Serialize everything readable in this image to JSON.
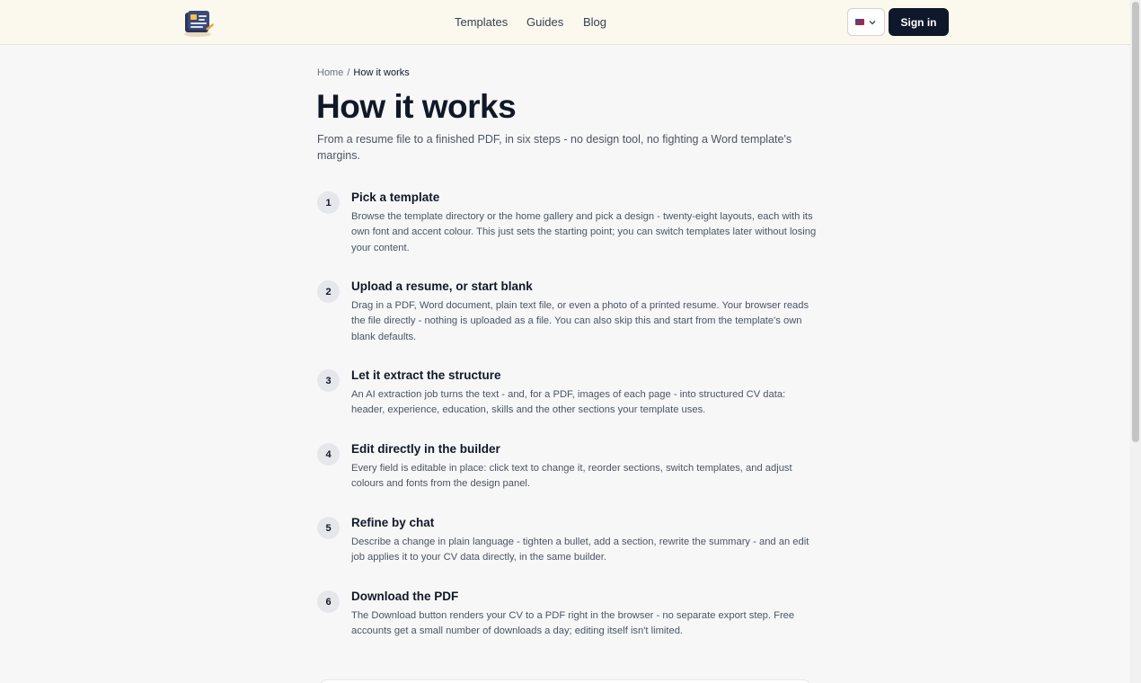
{
  "header": {
    "nav": [
      "Templates",
      "Guides",
      "Blog"
    ],
    "signin_label": "Sign in"
  },
  "breadcrumb": {
    "home": "Home",
    "separator": "/",
    "current": "How it works"
  },
  "page": {
    "title": "How it works",
    "subtitle": "From a resume file to a finished PDF, in six steps - no design tool, no fighting a Word template's margins."
  },
  "steps": [
    {
      "num": "1",
      "title": "Pick a template",
      "desc": "Browse the template directory or the home gallery and pick a design - twenty-eight layouts, each with its own font and accent colour. This just sets the starting point; you can switch templates later without losing your content."
    },
    {
      "num": "2",
      "title": "Upload a resume, or start blank",
      "desc": "Drag in a PDF, Word document, plain text file, or even a photo of a printed resume. Your browser reads the file directly - nothing is uploaded as a file. You can also skip this and start from the template's own blank defaults."
    },
    {
      "num": "3",
      "title": "Let it extract the structure",
      "desc": "An AI extraction job turns the text - and, for a PDF, images of each page - into structured CV data: header, experience, education, skills and the other sections your template uses."
    },
    {
      "num": "4",
      "title": "Edit directly in the builder",
      "desc": "Every field is editable in place: click text to change it, reorder sections, switch templates, and adjust colours and fonts from the design panel."
    },
    {
      "num": "5",
      "title": "Refine by chat",
      "desc": "Describe a change in plain language - tighten a bullet, add a section, rewrite the summary - and an edit job applies it to your CV data directly, in the same builder."
    },
    {
      "num": "6",
      "title": "Download the PDF",
      "desc": "The Download button renders your CV to a PDF right in the browser - no separate export step. Free accounts get a small number of downloads a day; editing itself isn't limited."
    }
  ]
}
